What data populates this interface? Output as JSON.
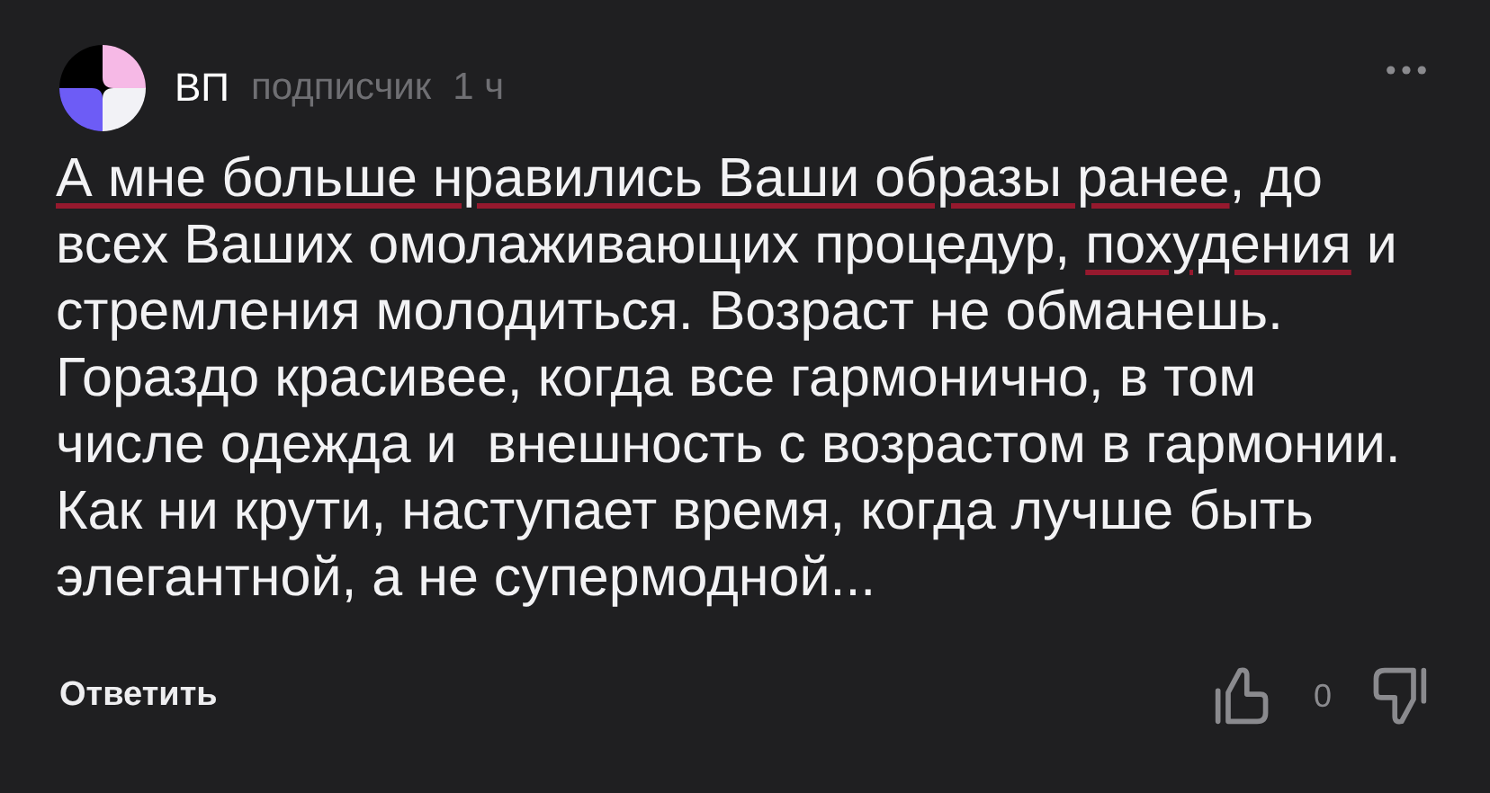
{
  "comment": {
    "author": "ВП",
    "role": "подписчик",
    "time": "1 ч",
    "lines": [
      [
        {
          "text": "А мне больше нравились Ваши образы ранее",
          "underlined": true
        },
        {
          "text": ", до",
          "underlined": false
        }
      ],
      [
        {
          "text": "всех Ваших омолаживающих процедур, ",
          "underlined": false
        },
        {
          "text": "похудения",
          "underlined": true
        },
        {
          "text": " и",
          "underlined": false
        }
      ],
      [
        {
          "text": "стремления молодиться. Возраст не обманешь.",
          "underlined": false
        }
      ],
      [
        {
          "text": "Гораздо красивее, когда все гармонично, в том",
          "underlined": false
        }
      ],
      [
        {
          "text": "числе одежда и  внешность с возрастом в гармонии.",
          "underlined": false
        }
      ],
      [
        {
          "text": "Как ни крути, наступает время, когда лучше быть",
          "underlined": false
        }
      ],
      [
        {
          "text": "элегантной, а не супермодной...",
          "underlined": false
        }
      ]
    ],
    "reply_label": "Ответить",
    "likes": "0"
  }
}
